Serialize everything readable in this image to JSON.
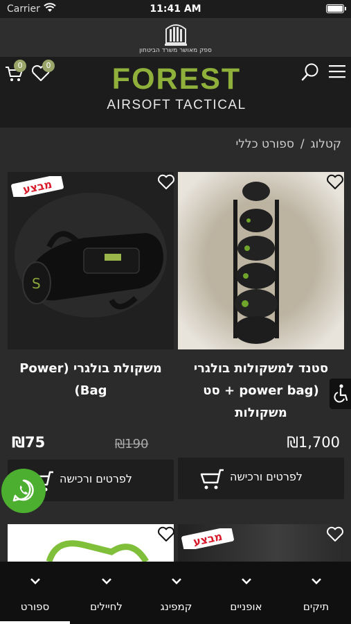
{
  "status_bar": {
    "carrier": "Carrier",
    "time": "11:41 AM"
  },
  "ministry": {
    "caption": "ספק מאושר משרד הביטחון"
  },
  "header": {
    "cart_count": "0",
    "wishlist_count": "0",
    "logo_main": "FOREST",
    "logo_sub": "AIRSOFT TACTICAL"
  },
  "breadcrumb": {
    "root": "קטלוג",
    "separator": "/",
    "current": "ספורט כללי"
  },
  "products": [
    {
      "title": "סטנד למשקולות בולגרי (power bag + סט משקולות",
      "price": "₪1,700",
      "button_label": "לפרטים ורכישה",
      "on_sale": false
    },
    {
      "title": "משקולת בולגרי (Power Bag)",
      "price": "₪75",
      "old_price": "₪190",
      "button_label": "לפרטים ורכישה",
      "on_sale": true,
      "sale_badge": "מבצע"
    },
    {
      "sale_badge": "מבצע"
    }
  ],
  "bottom_nav": [
    "תיקים",
    "אופניים",
    "קמפינג",
    "לחיילים",
    "ספורט"
  ],
  "colors": {
    "accent_green": "#8fb03a",
    "whatsapp": "#4caf30",
    "badge": "#9aa56a",
    "sale_red": "#d8192a"
  }
}
